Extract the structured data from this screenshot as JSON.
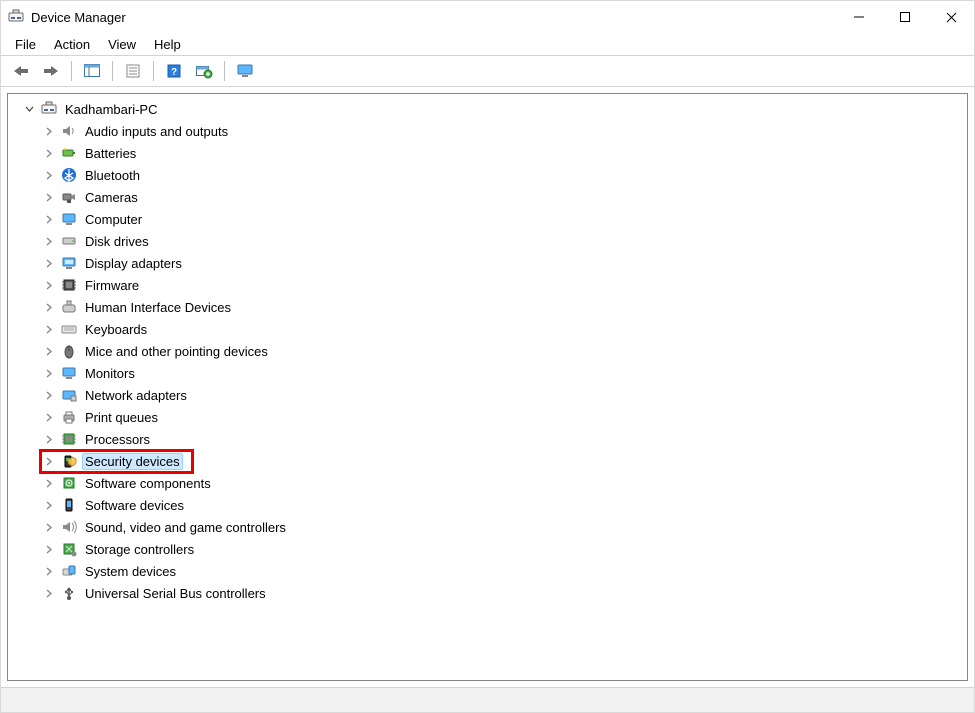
{
  "window": {
    "title": "Device Manager"
  },
  "menu": {
    "items": [
      "File",
      "Action",
      "View",
      "Help"
    ]
  },
  "root": {
    "label": "Kadhambari-PC",
    "expanded": true
  },
  "categories": [
    {
      "label": "Audio inputs and outputs",
      "icon": "speaker"
    },
    {
      "label": "Batteries",
      "icon": "battery"
    },
    {
      "label": "Bluetooth",
      "icon": "bluetooth"
    },
    {
      "label": "Cameras",
      "icon": "camera"
    },
    {
      "label": "Computer",
      "icon": "computer"
    },
    {
      "label": "Disk drives",
      "icon": "disk"
    },
    {
      "label": "Display adapters",
      "icon": "display-adapter"
    },
    {
      "label": "Firmware",
      "icon": "firmware"
    },
    {
      "label": "Human Interface Devices",
      "icon": "hid"
    },
    {
      "label": "Keyboards",
      "icon": "keyboard"
    },
    {
      "label": "Mice and other pointing devices",
      "icon": "mouse"
    },
    {
      "label": "Monitors",
      "icon": "monitor"
    },
    {
      "label": "Network adapters",
      "icon": "network"
    },
    {
      "label": "Print queues",
      "icon": "printer"
    },
    {
      "label": "Processors",
      "icon": "processor"
    },
    {
      "label": "Security devices",
      "icon": "security",
      "selected": true,
      "highlighted": true
    },
    {
      "label": "Software components",
      "icon": "software-component"
    },
    {
      "label": "Software devices",
      "icon": "software-device"
    },
    {
      "label": "Sound, video and game controllers",
      "icon": "sound"
    },
    {
      "label": "Storage controllers",
      "icon": "storage"
    },
    {
      "label": "System devices",
      "icon": "system"
    },
    {
      "label": "Universal Serial Bus controllers",
      "icon": "usb"
    }
  ]
}
